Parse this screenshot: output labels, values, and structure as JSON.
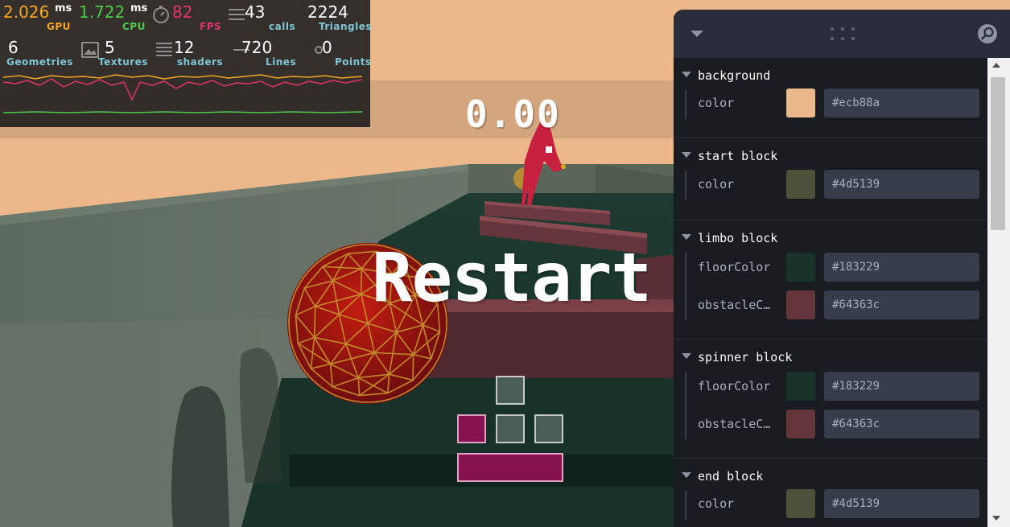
{
  "perf": {
    "metrics": [
      {
        "id": "gpu",
        "value": "2.026",
        "unit": "ms",
        "label": "GPU",
        "color": "#f5a623"
      },
      {
        "id": "cpu",
        "value": "1.722",
        "unit": "ms",
        "label": "CPU",
        "color": "#4ec94e"
      },
      {
        "id": "fps",
        "value": "82",
        "unit": "",
        "label": "FPS",
        "color": "#e0336b"
      },
      {
        "id": "calls",
        "value": "43",
        "unit": "",
        "label": "calls",
        "color": "#7fc6d6"
      },
      {
        "id": "triangles",
        "value": "2224",
        "unit": "",
        "label": "Triangles",
        "color": "#7fc6d6"
      },
      {
        "id": "geometries",
        "value": "6",
        "unit": "",
        "label": "Geometries",
        "color": "#7fc6d6"
      },
      {
        "id": "textures",
        "value": "5",
        "unit": "",
        "label": "Textures",
        "color": "#7fc6d6"
      },
      {
        "id": "shaders",
        "value": "12",
        "unit": "",
        "label": "shaders",
        "color": "#7fc6d6"
      },
      {
        "id": "lines",
        "value": "720",
        "unit": "",
        "label": "Lines",
        "color": "#7fc6d6"
      },
      {
        "id": "points",
        "value": "0",
        "unit": "",
        "label": "Points",
        "color": "#7fc6d6"
      }
    ]
  },
  "hud": {
    "timer": "0.00",
    "restart_label": "Restart",
    "keys": {
      "forward": false,
      "left": true,
      "backward": false,
      "right": false,
      "jump": true
    },
    "key_active_color": "#85114f",
    "key_idle_color": "#5a6e64"
  },
  "gui": {
    "icons": {
      "collapse": "chevron-down-icon",
      "drag": "drag-handle-icon",
      "search": "search-icon"
    },
    "folders": [
      {
        "id": "background",
        "title": "background",
        "rows": [
          {
            "label": "color",
            "value": "#ecb88a"
          }
        ]
      },
      {
        "id": "start",
        "title": "start block",
        "rows": [
          {
            "label": "color",
            "value": "#4d5139"
          }
        ]
      },
      {
        "id": "limbo",
        "title": "limbo block",
        "rows": [
          {
            "label": "floorColor",
            "value": "#183229"
          },
          {
            "label": "obstacleColor",
            "value": "#64363c"
          }
        ]
      },
      {
        "id": "spinner",
        "title": "spinner block",
        "rows": [
          {
            "label": "floorColor",
            "value": "#183229"
          },
          {
            "label": "obstacleColor",
            "value": "#64363c"
          }
        ]
      },
      {
        "id": "end",
        "title": "end block",
        "rows": [
          {
            "label": "color",
            "value": "#4d5139"
          }
        ]
      }
    ]
  },
  "scene": {
    "sky_color": "#ecb88a",
    "start_color": "#4d5139",
    "floor_color": "#183229",
    "obstacle_color": "#64363c",
    "ball_color": "#a01818",
    "ball_wire_color": "#c9962e",
    "character_color": "#c7203e"
  }
}
